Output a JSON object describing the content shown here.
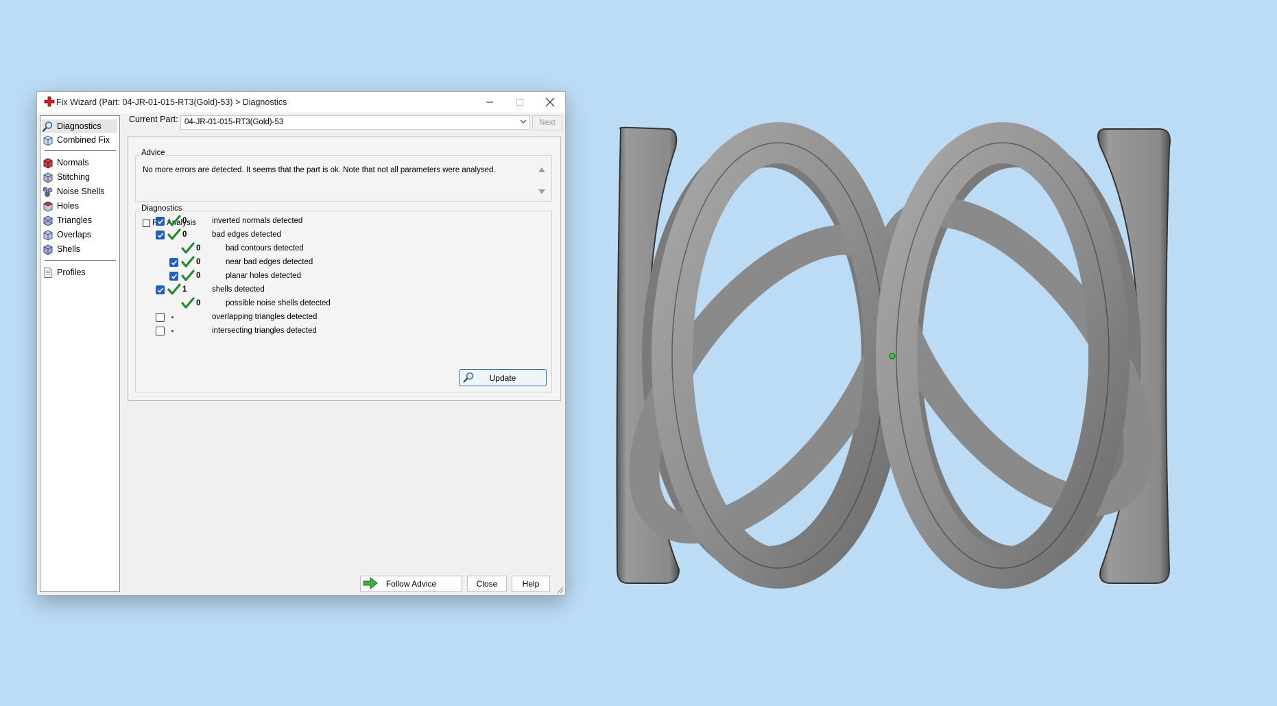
{
  "window": {
    "title": "Fix Wizard (Part: 04-JR-01-015-RT3(Gold)-53) > Diagnostics",
    "icon": "red-cross-icon"
  },
  "sidebar": {
    "items": [
      {
        "label": "Diagnostics",
        "icon": "magnifier-icon",
        "selected": true
      },
      {
        "label": "Combined Fix",
        "icon": "cube-icon"
      },
      {
        "label": "Normals",
        "icon": "cube-red-icon"
      },
      {
        "label": "Stitching",
        "icon": "cube-stitch-icon"
      },
      {
        "label": "Noise Shells",
        "icon": "noise-shells-icon"
      },
      {
        "label": "Holes",
        "icon": "cube-red-icon"
      },
      {
        "label": "Triangles",
        "icon": "triangles-icon"
      },
      {
        "label": "Overlaps",
        "icon": "cube-icon"
      },
      {
        "label": "Shells",
        "icon": "cube-icon"
      },
      {
        "label": "Profiles",
        "icon": "document-icon"
      }
    ]
  },
  "current_part": {
    "label": "Current Part:",
    "value": "04-JR-01-015-RT3(Gold)-53",
    "next_label": "Next"
  },
  "advice": {
    "title": "Advice",
    "text": "No more errors are detected. It seems that the part is ok. Note that not all parameters were analysed."
  },
  "diagnostics": {
    "title": "Diagnostics",
    "full_analysis_label": "Full Analysis",
    "full_analysis_checked": false,
    "rows": [
      {
        "checkbox": "checked",
        "status": "ok",
        "count": "0",
        "label": "inverted normals detected",
        "indent": 0
      },
      {
        "checkbox": "checked",
        "status": "ok",
        "count": "0",
        "label": "bad edges detected",
        "indent": 0
      },
      {
        "checkbox": "none",
        "status": "ok",
        "count": "0",
        "label": "bad contours detected",
        "indent": 1
      },
      {
        "checkbox": "checked",
        "status": "ok",
        "count": "0",
        "label": "near bad edges detected",
        "indent": 1
      },
      {
        "checkbox": "checked",
        "status": "ok",
        "count": "0",
        "label": "planar holes detected",
        "indent": 1
      },
      {
        "checkbox": "checked",
        "status": "ok",
        "count": "1",
        "label": "shells detected",
        "indent": 0
      },
      {
        "checkbox": "none",
        "status": "ok",
        "count": "0",
        "label": "possible noise shells detected",
        "indent": 1
      },
      {
        "checkbox": "unchecked",
        "status": "dot",
        "count": "",
        "label": "overlapping triangles detected",
        "indent": 0
      },
      {
        "checkbox": "unchecked",
        "status": "dot",
        "count": "",
        "label": "intersecting triangles detected",
        "indent": 0
      }
    ],
    "update_label": "Update"
  },
  "footer": {
    "follow_advice_label": "Follow Advice",
    "close_label": "Close",
    "help_label": "Help"
  },
  "colors": {
    "viewport_background": "#bcdcf6",
    "model_gray": "#8e8e8e",
    "check_green": "#1f8a2e",
    "checkbox_blue": "#1e5ec8",
    "pivot_green": "#2ecc40"
  }
}
